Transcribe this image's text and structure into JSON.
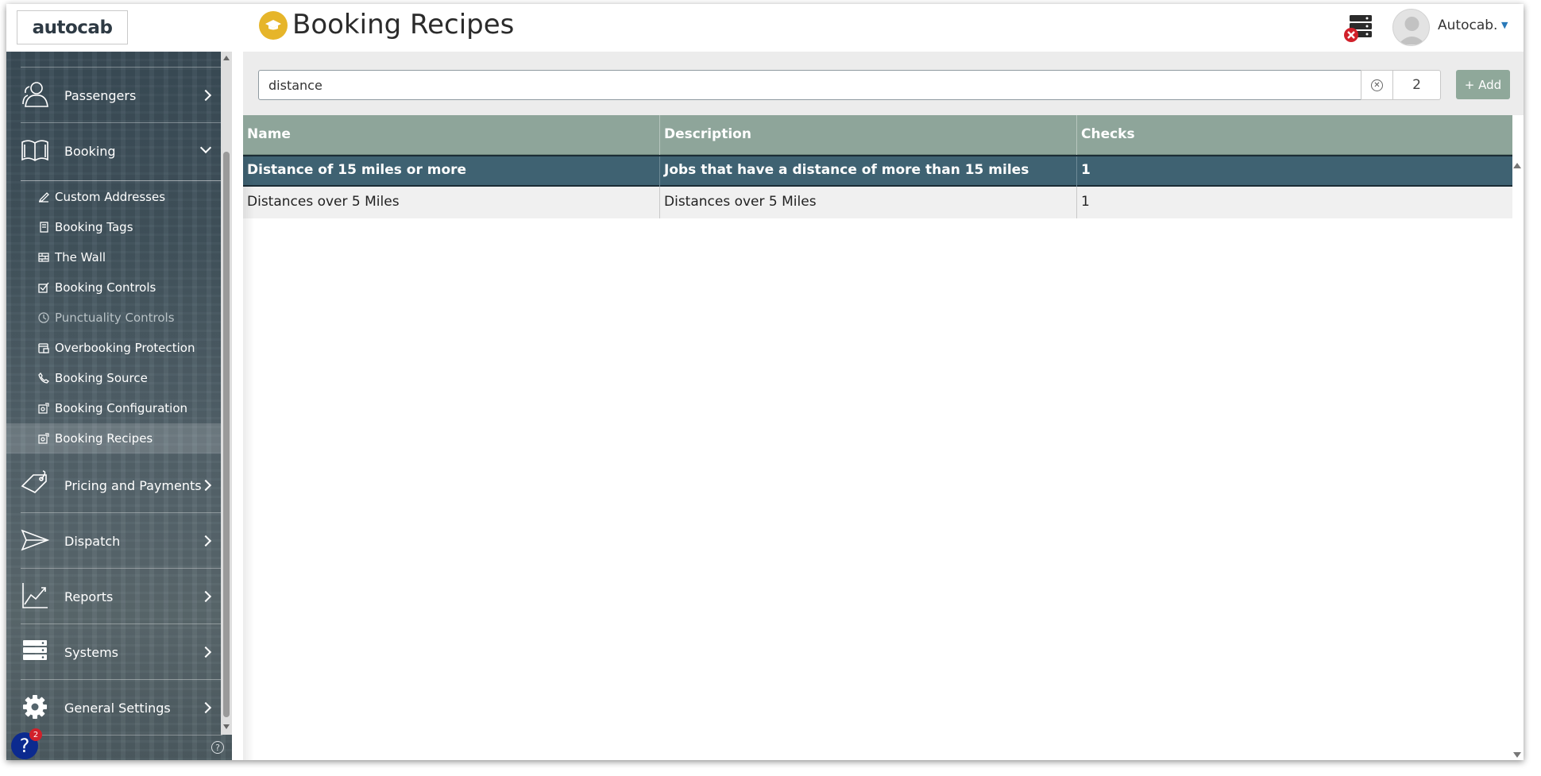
{
  "app": {
    "logo_text": "autocab",
    "page_title": "Booking Recipes",
    "user_name": "Autocab.",
    "help_badge_count": "2",
    "help_symbol": "?",
    "small_help_symbol": "?"
  },
  "sidebar": {
    "items": [
      {
        "label": "Passengers",
        "icon": "passengers-icon"
      },
      {
        "label": "Booking",
        "icon": "book-icon",
        "expanded": true
      },
      {
        "label": "Pricing and Payments",
        "icon": "price-tag-icon"
      },
      {
        "label": "Dispatch",
        "icon": "paper-plane-icon"
      },
      {
        "label": "Reports",
        "icon": "line-chart-icon"
      },
      {
        "label": "Systems",
        "icon": "server-icon"
      },
      {
        "label": "General Settings",
        "icon": "gear-icon"
      }
    ],
    "booking_subitems": [
      {
        "label": "Custom Addresses",
        "icon": "address-edit-icon"
      },
      {
        "label": "Booking Tags",
        "icon": "tag-doc-icon"
      },
      {
        "label": "The Wall",
        "icon": "wall-icon"
      },
      {
        "label": "Booking Controls",
        "icon": "checkbox-icon"
      },
      {
        "label": "Punctuality Controls",
        "icon": "clock-icon",
        "disabled": true
      },
      {
        "label": "Overbooking Protection",
        "icon": "calendar-lock-icon"
      },
      {
        "label": "Booking Source",
        "icon": "phone-icon"
      },
      {
        "label": "Booking Configuration",
        "icon": "config-icon"
      },
      {
        "label": "Booking Recipes",
        "icon": "recipe-icon",
        "active": true
      }
    ]
  },
  "toolbar": {
    "search_value": "distance",
    "result_count": "2",
    "add_label": "+ Add"
  },
  "table": {
    "columns": [
      "Name",
      "Description",
      "Checks"
    ],
    "rows": [
      {
        "name": "Distance of 15 miles or more",
        "description": "Jobs that have a distance of more than 15 miles",
        "checks": "1",
        "selected": true
      },
      {
        "name": "Distances over 5 Miles",
        "description": "Distances over 5 Miles",
        "checks": "1"
      }
    ]
  },
  "colors": {
    "header_green": "#8ea59a",
    "selected_row": "#3f6272",
    "sidebar_bg": "#42545e",
    "title_icon": "#e6b52a",
    "help_blue": "#0c2a8f",
    "badge_red": "#d1202a"
  }
}
